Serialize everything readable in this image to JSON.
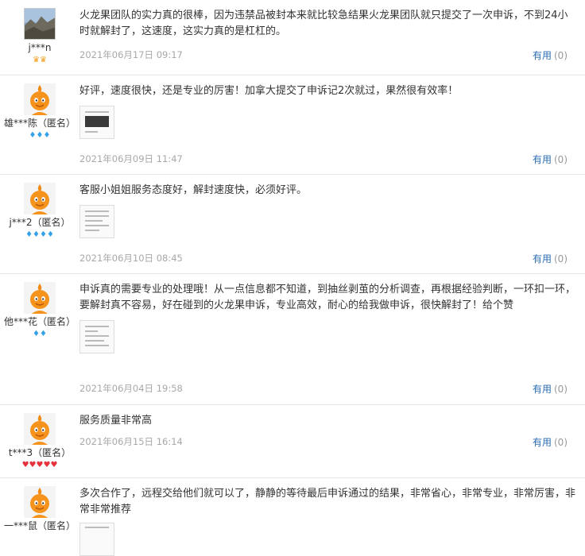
{
  "reviews": [
    {
      "user": "j***n",
      "avatar": "photo",
      "badge_type": "crown",
      "badges": "♛♛",
      "text": "火龙果团队的实力真的很棒，因为违禁品被封本来就比较急结果火龙果团队就只提交了一次申诉，不到24小时就解封了，这速度，这实力真的是杠杠的。",
      "date": "2021年06月17日  09:17",
      "useful_label": "有用",
      "useful_count": "(0)"
    },
    {
      "user": "雄***陈（匿名）",
      "avatar": "default",
      "badge_type": "diamond",
      "badges": "♦♦♦",
      "text": "好评，速度很快，还是专业的厉害！加拿大提交了申诉记2次就过，果然很有效率！",
      "date": "2021年06月09日  11:47",
      "useful_label": "有用",
      "useful_count": "(0)"
    },
    {
      "user": "j***2（匿名）",
      "avatar": "default",
      "badge_type": "diamond",
      "badges": "♦♦♦♦",
      "text": "客服小姐姐服务态度好，解封速度快，必须好评。",
      "date": "2021年06月10日  08:45",
      "useful_label": "有用",
      "useful_count": "(0)"
    },
    {
      "user": "他***花（匿名）",
      "avatar": "default",
      "badge_type": "diamond",
      "badges": "♦♦",
      "text": "申诉真的需要专业的处理哦！从一点信息都不知道，到抽丝剥茧的分析调查，再根据经验判断，一环扣一环，要解封真不容易，好在碰到的火龙果申诉，专业高效，耐心的给我做申诉，很快解封了！给个赞",
      "date": "2021年06月04日  19:58",
      "useful_label": "有用",
      "useful_count": "(0)"
    },
    {
      "user": "t***3（匿名）",
      "avatar": "default",
      "badge_type": "heart",
      "badges": "♥♥♥♥♥",
      "text": "服务质量非常高",
      "date": "2021年06月15日  16:14",
      "useful_label": "有用",
      "useful_count": "(0)"
    },
    {
      "user": "一***鼠（匿名）",
      "avatar": "default",
      "badge_type": "heart",
      "badges": "",
      "text": "多次合作了，远程交给他们就可以了，静静的等待最后申诉通过的结果，非常省心，非常专业，非常厉害，非常非常推荐",
      "date": "",
      "useful_label": "",
      "useful_count": ""
    }
  ]
}
